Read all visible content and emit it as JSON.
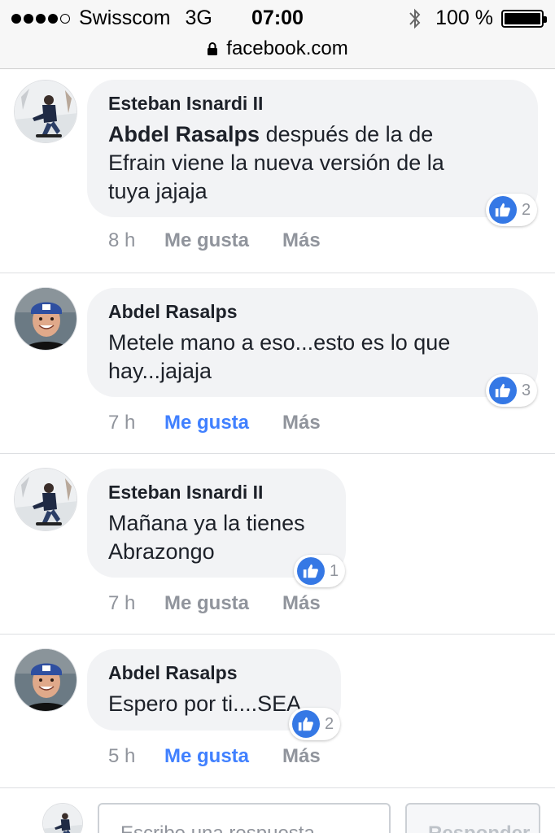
{
  "status_bar": {
    "carrier": "Swisscom",
    "network": "3G",
    "time": "07:00",
    "battery": "100 %",
    "signal_bars_filled": 4,
    "signal_bars_total": 5,
    "battery_level": 1.0
  },
  "url_bar": {
    "url": "facebook.com"
  },
  "colors": {
    "like_blue": "#4080ff",
    "reaction_blue": "#3578e5",
    "bubble_bg": "#f2f3f5",
    "meta_gray": "#90949c"
  },
  "comments": [
    {
      "author": "Esteban Isnardi II",
      "mention": "Abdel Rasalps",
      "text_line1": " después de la de",
      "text_line2": "Efrain viene la nueva versión de la",
      "text_line3": "tuya jajaja",
      "reaction_count": "2",
      "time": "8 h",
      "like_label": "Me gusta",
      "like_active": false,
      "more_label": "Más",
      "avatar_icon": "skater-avatar-icon"
    },
    {
      "author": "Abdel Rasalps",
      "text_line1": "Metele mano a eso...esto es lo que",
      "text_line2": "hay...jajaja",
      "reaction_count": "3",
      "time": "7 h",
      "like_label": "Me gusta",
      "like_active": true,
      "more_label": "Más",
      "avatar_icon": "smiling-man-cap-avatar-icon"
    },
    {
      "author": "Esteban Isnardi II",
      "text_line1": "Mañana ya la tienes",
      "text_line2": "Abrazongo",
      "reaction_count": "1",
      "time": "7 h",
      "like_label": "Me gusta",
      "like_active": false,
      "more_label": "Más",
      "avatar_icon": "skater-avatar-icon"
    },
    {
      "author": "Abdel Rasalps",
      "text_line1": "Espero por ti....SEA",
      "reaction_count": "2",
      "time": "5 h",
      "like_label": "Me gusta",
      "like_active": true,
      "more_label": "Más",
      "avatar_icon": "smiling-man-cap-avatar-icon"
    }
  ],
  "composer": {
    "placeholder": "Escribe una respuesta...",
    "button_label": "Responder"
  }
}
